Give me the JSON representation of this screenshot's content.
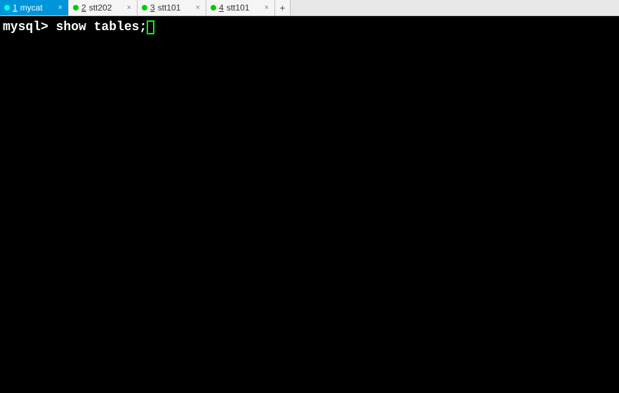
{
  "tabs": [
    {
      "number": "1",
      "label": "mycat",
      "active": true,
      "dot": "cyan"
    },
    {
      "number": "2",
      "label": "stt202",
      "active": false,
      "dot": "green"
    },
    {
      "number": "3",
      "label": "stt101",
      "active": false,
      "dot": "green"
    },
    {
      "number": "4",
      "label": "stt101",
      "active": false,
      "dot": "green"
    }
  ],
  "addTab": "+",
  "closeGlyph": "×",
  "terminal": {
    "prompt": "mysql> ",
    "command": "show tables;"
  }
}
